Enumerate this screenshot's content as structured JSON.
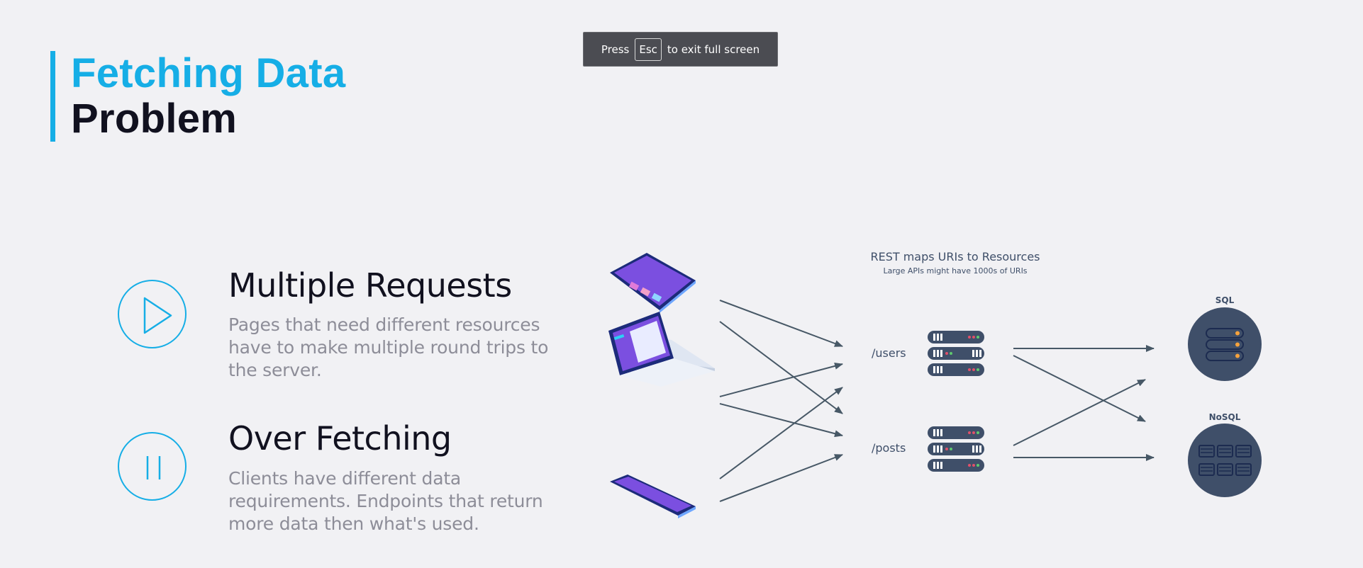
{
  "title": {
    "accent": "Fetching Data",
    "main": "Problem"
  },
  "fullscreen_toast": {
    "prefix": "Press",
    "key": "Esc",
    "suffix": "to exit full screen"
  },
  "items": [
    {
      "icon": "play-icon",
      "heading": "Multiple Requests",
      "lines": [
        "Pages that need different resources",
        "have to make multiple round trips to",
        "the server."
      ]
    },
    {
      "icon": "pause-icon",
      "heading": "Over Fetching",
      "lines": [
        "Clients have different data",
        "requirements. Endpoints that return",
        "more data then what's used."
      ]
    }
  ],
  "diagram": {
    "caption": "REST maps URIs to Resources",
    "subcaption": "Large APIs might have 1000s of URIs",
    "routes": [
      "/users",
      "/posts"
    ],
    "databases": [
      "SQL",
      "NoSQL"
    ],
    "clients": [
      "tablet-icon",
      "laptop-icon",
      "phone-icon"
    ],
    "colors": {
      "accent": "#16aee6",
      "device_navy": "#1c2b7a",
      "device_purple": "#7b4fe0",
      "server": "#3f4f69",
      "arrow": "#475866"
    }
  }
}
